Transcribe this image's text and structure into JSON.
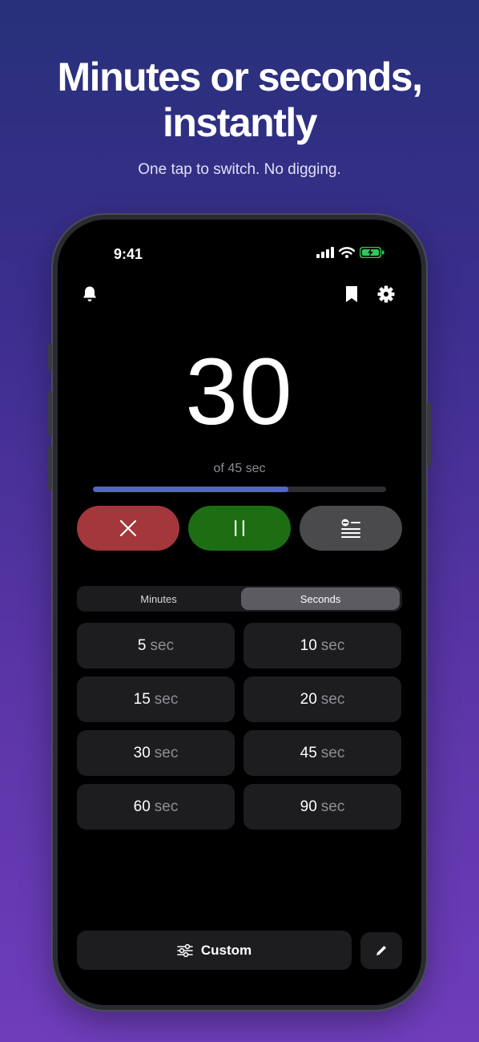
{
  "promo": {
    "headline_line1": "Minutes or seconds,",
    "headline_line2": "instantly",
    "subheadline": "One tap to switch. No digging."
  },
  "status_bar": {
    "time": "9:41",
    "icons": [
      "cellular-signal-icon",
      "wifi-icon",
      "battery-charging-icon"
    ],
    "battery_color": "#34c759"
  },
  "toolbar": {
    "left_icons": [
      "bell-icon"
    ],
    "right_icons": [
      "bookmark-icon",
      "gear-icon"
    ]
  },
  "timer": {
    "remaining": "30",
    "total_label": "of 45 sec",
    "progress_fraction": 0.667,
    "progress_color": "#5166c5"
  },
  "controls": {
    "cancel_icon": "close-icon",
    "pause_icon": "pause-icon",
    "list_icon": "list-icon",
    "cancel_color": "#a3373c",
    "pause_color": "#1d6e13",
    "list_color": "#4a4a4d"
  },
  "unit_toggle": {
    "options": [
      "Minutes",
      "Seconds"
    ],
    "selected": "Seconds"
  },
  "presets": [
    {
      "value": "5",
      "unit": "sec"
    },
    {
      "value": "10",
      "unit": "sec"
    },
    {
      "value": "15",
      "unit": "sec"
    },
    {
      "value": "20",
      "unit": "sec"
    },
    {
      "value": "30",
      "unit": "sec"
    },
    {
      "value": "45",
      "unit": "sec"
    },
    {
      "value": "60",
      "unit": "sec"
    },
    {
      "value": "90",
      "unit": "sec"
    }
  ],
  "bottom": {
    "custom_label": "Custom",
    "custom_icon": "sliders-icon",
    "edit_icon": "pencil-icon"
  }
}
